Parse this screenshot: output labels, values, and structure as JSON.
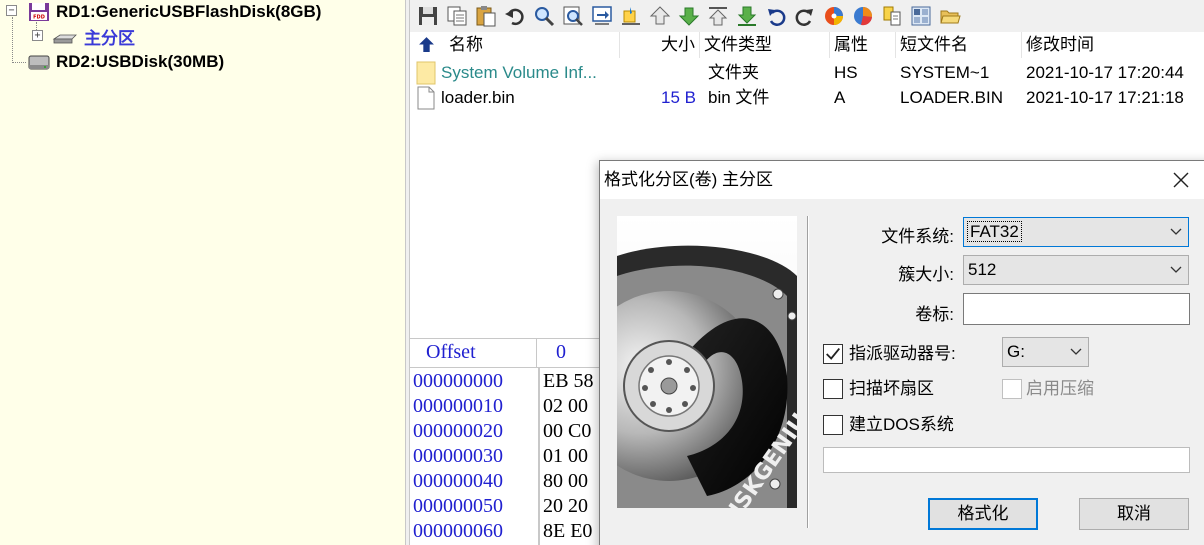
{
  "tree": {
    "nodes": [
      {
        "label": "RD1:GenericUSBFlashDisk(8GB)",
        "icon": "floppy-disk-icon",
        "expander": "−"
      },
      {
        "label": "主分区",
        "icon": "partition-icon",
        "expander": "+"
      },
      {
        "label": "RD2:USBDisk(30MB)",
        "icon": "hard-disk-icon"
      }
    ]
  },
  "toolbar": {
    "buttons": [
      "save-icon",
      "copy-icon",
      "paste-icon",
      "undo-icon",
      "search-icon",
      "find-next-icon",
      "goto-icon",
      "clear-icon",
      "up-icon",
      "down-icon",
      "top-icon",
      "bottom-icon",
      "back-icon",
      "refresh-icon",
      "diskgenius-icon",
      "pie-chart-icon",
      "copy-sector-icon",
      "grid-icon",
      "open-folder-icon"
    ]
  },
  "filelist": {
    "up_icon": "up-arrow-icon",
    "columns": [
      "名称",
      "大小",
      "文件类型",
      "属性",
      "短文件名",
      "修改时间"
    ],
    "rows": [
      {
        "name": "System Volume Inf...",
        "size": "",
        "type": "文件夹",
        "attr": "HS",
        "short": "SYSTEM~1",
        "mtime": "2021-10-17 17:20:44"
      },
      {
        "name": "loader.bin",
        "size": "15 B",
        "type": "bin 文件",
        "attr": "A",
        "short": "LOADER.BIN",
        "mtime": "2021-10-17 17:21:18"
      }
    ]
  },
  "hex": {
    "header_offset": "Offset",
    "header_col0": "0",
    "offsets": [
      "000000000",
      "000000010",
      "000000020",
      "000000030",
      "000000040",
      "000000050",
      "000000060"
    ],
    "bytes": [
      "EB 58",
      "02 00",
      "00 C0",
      "01 00",
      "80 00",
      "20 20",
      "8E E0"
    ]
  },
  "dialog": {
    "title": "格式化分区(卷) 主分区",
    "filesystem_label": "文件系统:",
    "filesystem_value": "FAT32",
    "cluster_label": "簇大小:",
    "cluster_value": "512",
    "volume_label": "卷标:",
    "volume_value": "",
    "assign_drive_label": "指派驱动器号:",
    "assign_drive_checked": true,
    "drive_letter": "G:",
    "scan_bad_label": "扫描坏扇区",
    "scan_bad_checked": false,
    "compress_label": "启用压缩",
    "compress_checked": false,
    "dos_label": "建立DOS系统",
    "dos_checked": false,
    "progress": 0,
    "format_button": "格式化",
    "cancel_button": "取消",
    "banner_text": "DISKGENIUS"
  },
  "colors": {
    "tree_bg": "#ffffe9",
    "folder_text": "#2a8a8a",
    "size_text": "#2020d0",
    "hex_offset": "#2020d0",
    "accent": "#0078d7"
  }
}
